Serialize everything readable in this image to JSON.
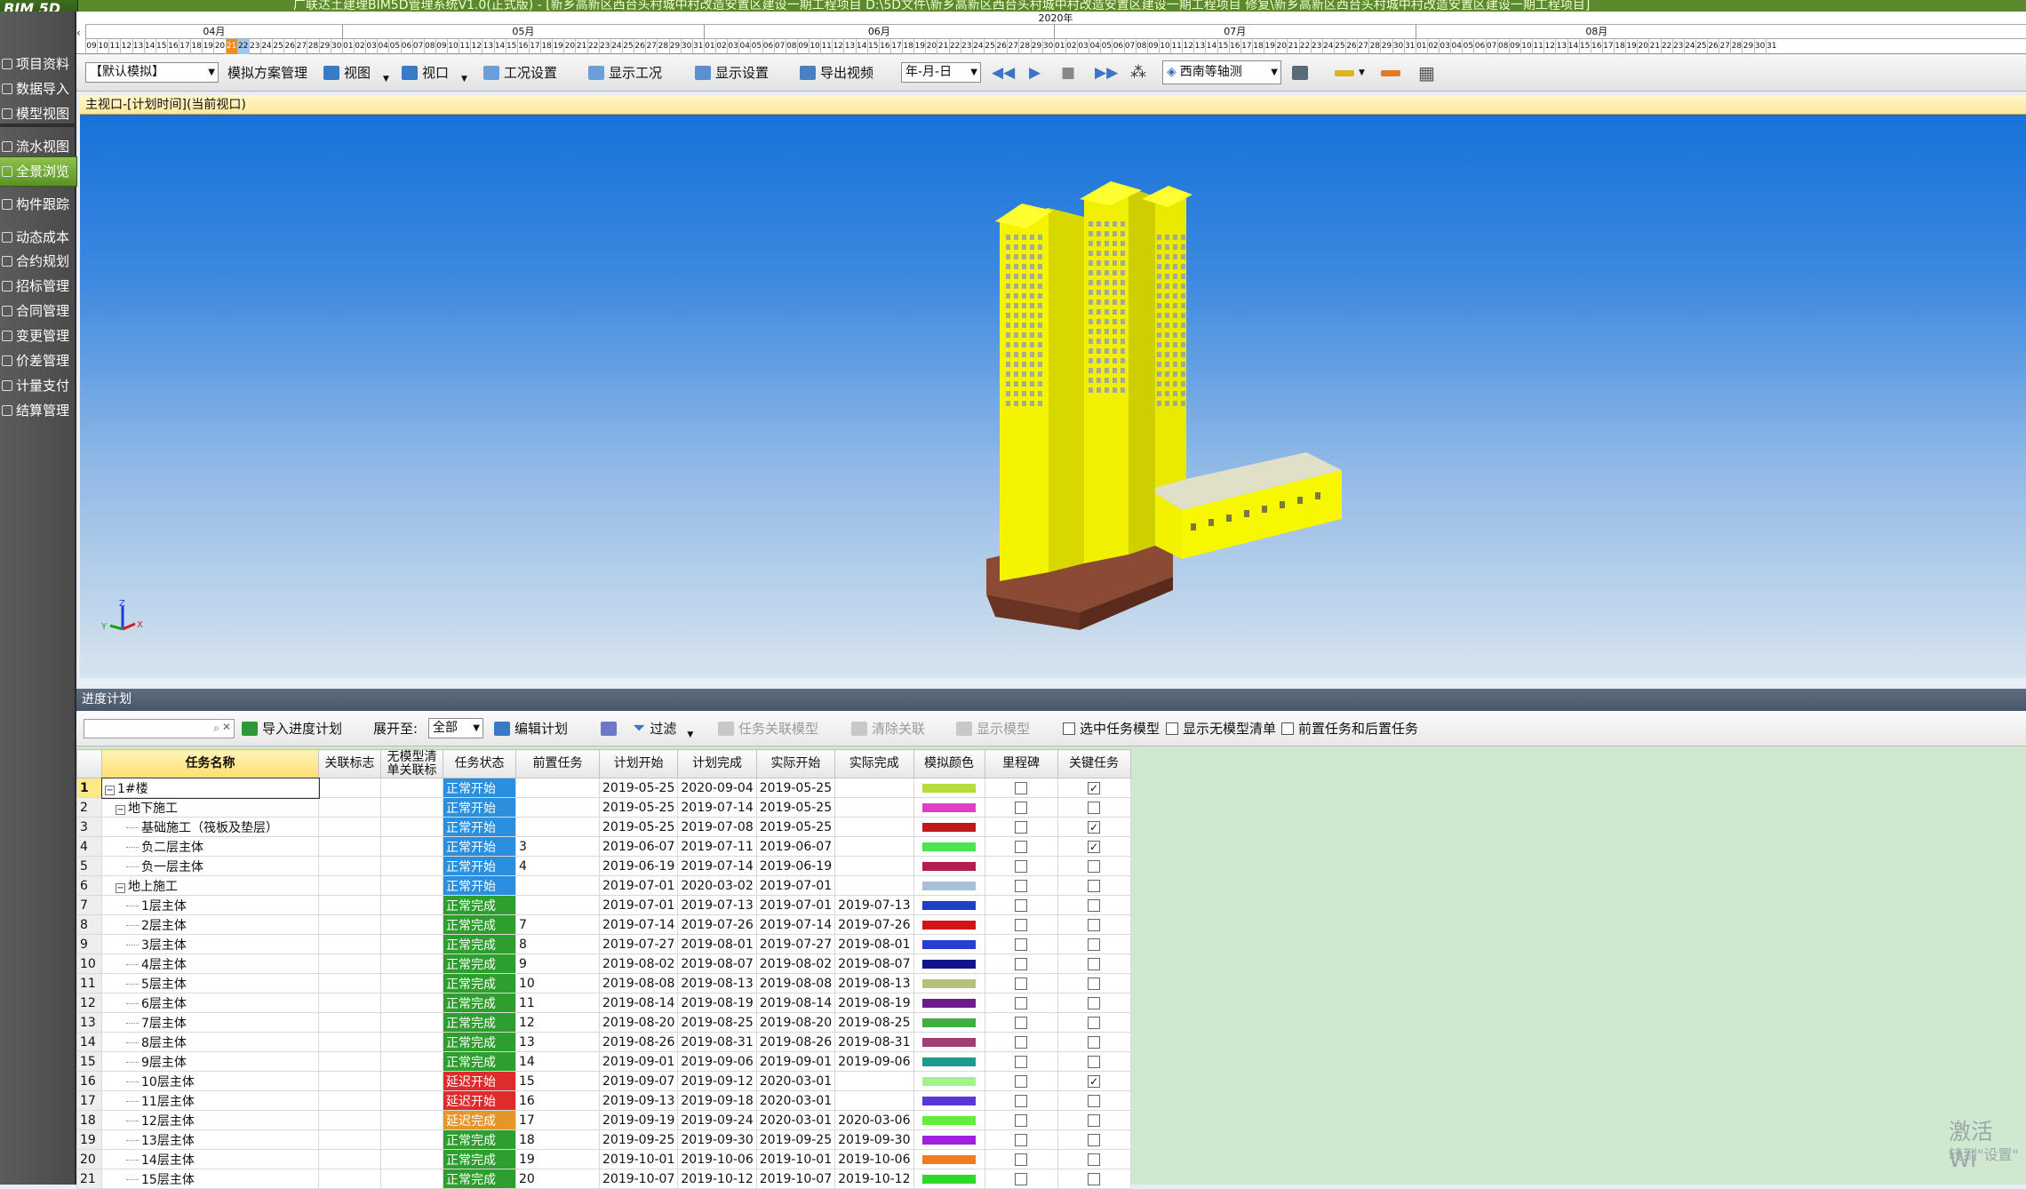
{
  "app": {
    "logo": "BIM 5D",
    "window_title": "广联达土建理BIM5D管理系统V1.0(正式版) - [新乡高新区西台头村城中村改造安置区建设一期工程项目 D:\\5D文件\\新乡高新区西台头村城中村改造安置区建设一期工程项目 修复\\新乡高新区西台头村城中村改造安置区建设一期工程项目]"
  },
  "sidebar": {
    "items": [
      {
        "label": "项目资料",
        "icon": "folder-icon"
      },
      {
        "label": "数据导入",
        "icon": "import-icon"
      },
      {
        "label": "模型视图",
        "icon": "model-icon"
      },
      {
        "label": "流水视图",
        "icon": "flow-icon"
      },
      {
        "label": "全景浏览",
        "icon": "panorama-icon"
      },
      {
        "label": "构件跟踪",
        "icon": "track-icon"
      },
      {
        "label": "动态成本",
        "icon": "cost-icon"
      },
      {
        "label": "合约规划",
        "icon": "contract-plan-icon"
      },
      {
        "label": "招标管理",
        "icon": "bid-icon"
      },
      {
        "label": "合同管理",
        "icon": "contract-icon"
      },
      {
        "label": "变更管理",
        "icon": "change-icon"
      },
      {
        "label": "价差管理",
        "icon": "price-diff-icon"
      },
      {
        "label": "计量支付",
        "icon": "payment-icon"
      },
      {
        "label": "结算管理",
        "icon": "settlement-icon"
      }
    ]
  },
  "timeline": {
    "year": "2020年",
    "months": [
      {
        "label": "04月"
      },
      {
        "label": "05月"
      },
      {
        "label": "06月"
      },
      {
        "label": "07月"
      },
      {
        "label": "08月"
      }
    ],
    "today_day": "21"
  },
  "toolbar": {
    "sim_select": "【默认模拟】",
    "sim_scheme": "模拟方案管理",
    "view": "视图",
    "viewport": "视口",
    "condition_settings": "工况设置",
    "show_condition": "显示工况",
    "display_settings": "显示设置",
    "export_video": "导出视频",
    "date_format": "年-月-日",
    "view_direction": "西南等轴测"
  },
  "viewport": {
    "title": "主视口-[计划时间](当前视口)",
    "axis_z": "Z",
    "axis_y": "Y",
    "axis_x": "X"
  },
  "plan": {
    "header": "进度计划",
    "search_placeholder": "",
    "import_plan": "导入进度计划",
    "expand_label": "展开至:",
    "expand_value": "全部",
    "edit_plan": "编辑计划",
    "filter": "过滤",
    "task_link_model": "任务关联模型",
    "clear_link": "清除关联",
    "show_model": "显示模型",
    "opt_selected_model": "选中任务模型",
    "opt_no_model_list": "显示无模型清单",
    "opt_pre_post": "前置任务和后置任务"
  },
  "grid": {
    "columns": [
      "任务名称",
      "关联标志",
      "无模型清单关联标",
      "任务状态",
      "前置任务",
      "计划开始",
      "计划完成",
      "实际开始",
      "实际完成",
      "模拟颜色",
      "里程碑",
      "关键任务"
    ],
    "rows": [
      {
        "n": "1",
        "name": "1#楼",
        "lvl": 0,
        "exp": "⊟",
        "status": "正常开始",
        "st": "ok",
        "pre": "",
        "ps": "2019-05-25",
        "pf": "2020-09-04",
        "as": "2019-05-25",
        "af": "",
        "color": "#b7dd3c",
        "ms": false,
        "key": true
      },
      {
        "n": "2",
        "name": "地下施工",
        "lvl": 1,
        "exp": "⊟",
        "status": "正常开始",
        "st": "ok",
        "pre": "",
        "ps": "2019-05-25",
        "pf": "2019-07-14",
        "as": "2019-05-25",
        "af": "",
        "color": "#e040c8",
        "ms": false,
        "key": false
      },
      {
        "n": "3",
        "name": "基础施工（筏板及垫层）",
        "lvl": 2,
        "exp": "",
        "status": "正常开始",
        "st": "ok",
        "pre": "",
        "ps": "2019-05-25",
        "pf": "2019-07-08",
        "as": "2019-05-25",
        "af": "",
        "color": "#c0181c",
        "ms": false,
        "key": true
      },
      {
        "n": "4",
        "name": "负二层主体",
        "lvl": 2,
        "exp": "",
        "status": "正常开始",
        "st": "ok",
        "pre": "3",
        "ps": "2019-06-07",
        "pf": "2019-07-11",
        "as": "2019-06-07",
        "af": "",
        "color": "#4ce352",
        "ms": false,
        "key": true
      },
      {
        "n": "5",
        "name": "负一层主体",
        "lvl": 2,
        "exp": "",
        "status": "正常开始",
        "st": "ok",
        "pre": "4",
        "ps": "2019-06-19",
        "pf": "2019-07-14",
        "as": "2019-06-19",
        "af": "",
        "color": "#b01e50",
        "ms": false,
        "key": false
      },
      {
        "n": "6",
        "name": "地上施工",
        "lvl": 1,
        "exp": "⊟",
        "status": "正常开始",
        "st": "ok",
        "pre": "",
        "ps": "2019-07-01",
        "pf": "2020-03-02",
        "as": "2019-07-01",
        "af": "",
        "color": "#a8c0d8",
        "ms": false,
        "key": false
      },
      {
        "n": "7",
        "name": "1层主体",
        "lvl": 2,
        "exp": "",
        "status": "正常完成",
        "st": "done",
        "pre": "",
        "ps": "2019-07-01",
        "pf": "2019-07-13",
        "as": "2019-07-01",
        "af": "2019-07-13",
        "color": "#1e3fbf",
        "ms": false,
        "key": false
      },
      {
        "n": "8",
        "name": "2层主体",
        "lvl": 2,
        "exp": "",
        "status": "正常完成",
        "st": "done",
        "pre": "7",
        "ps": "2019-07-14",
        "pf": "2019-07-26",
        "as": "2019-07-14",
        "af": "2019-07-26",
        "color": "#d41414",
        "ms": false,
        "key": false
      },
      {
        "n": "9",
        "name": "3层主体",
        "lvl": 2,
        "exp": "",
        "status": "正常完成",
        "st": "done",
        "pre": "8",
        "ps": "2019-07-27",
        "pf": "2019-08-01",
        "as": "2019-07-27",
        "af": "2019-08-01",
        "color": "#2540d0",
        "ms": false,
        "key": false
      },
      {
        "n": "10",
        "name": "4层主体",
        "lvl": 2,
        "exp": "",
        "status": "正常完成",
        "st": "done",
        "pre": "9",
        "ps": "2019-08-02",
        "pf": "2019-08-07",
        "as": "2019-08-02",
        "af": "2019-08-07",
        "color": "#14148a",
        "ms": false,
        "key": false
      },
      {
        "n": "11",
        "name": "5层主体",
        "lvl": 2,
        "exp": "",
        "status": "正常完成",
        "st": "done",
        "pre": "10",
        "ps": "2019-08-08",
        "pf": "2019-08-13",
        "as": "2019-08-08",
        "af": "2019-08-13",
        "color": "#b5c07a",
        "ms": false,
        "key": false
      },
      {
        "n": "12",
        "name": "6层主体",
        "lvl": 2,
        "exp": "",
        "status": "正常完成",
        "st": "done",
        "pre": "11",
        "ps": "2019-08-14",
        "pf": "2019-08-19",
        "as": "2019-08-14",
        "af": "2019-08-19",
        "color": "#6e1e8a",
        "ms": false,
        "key": false
      },
      {
        "n": "13",
        "name": "7层主体",
        "lvl": 2,
        "exp": "",
        "status": "正常完成",
        "st": "done",
        "pre": "12",
        "ps": "2019-08-20",
        "pf": "2019-08-25",
        "as": "2019-08-20",
        "af": "2019-08-25",
        "color": "#3fb03f",
        "ms": false,
        "key": false
      },
      {
        "n": "14",
        "name": "8层主体",
        "lvl": 2,
        "exp": "",
        "status": "正常完成",
        "st": "done",
        "pre": "13",
        "ps": "2019-08-26",
        "pf": "2019-08-31",
        "as": "2019-08-26",
        "af": "2019-08-31",
        "color": "#a04070",
        "ms": false,
        "key": false
      },
      {
        "n": "15",
        "name": "9层主体",
        "lvl": 2,
        "exp": "",
        "status": "正常完成",
        "st": "done",
        "pre": "14",
        "ps": "2019-09-01",
        "pf": "2019-09-06",
        "as": "2019-09-01",
        "af": "2019-09-06",
        "color": "#1e9a8a",
        "ms": false,
        "key": false
      },
      {
        "n": "16",
        "name": "10层主体",
        "lvl": 2,
        "exp": "",
        "status": "延迟开始",
        "st": "late",
        "pre": "15",
        "ps": "2019-09-07",
        "pf": "2019-09-12",
        "as": "2020-03-01",
        "af": "",
        "color": "#a6f28a",
        "ms": false,
        "key": true
      },
      {
        "n": "17",
        "name": "11层主体",
        "lvl": 2,
        "exp": "",
        "status": "延迟开始",
        "st": "late",
        "pre": "16",
        "ps": "2019-09-13",
        "pf": "2019-09-18",
        "as": "2020-03-01",
        "af": "",
        "color": "#5a36d8",
        "ms": false,
        "key": false
      },
      {
        "n": "18",
        "name": "12层主体",
        "lvl": 2,
        "exp": "",
        "status": "延迟完成",
        "st": "latedone",
        "pre": "17",
        "ps": "2019-09-19",
        "pf": "2019-09-24",
        "as": "2020-03-01",
        "af": "2020-03-06",
        "color": "#62ef3c",
        "ms": false,
        "key": false
      },
      {
        "n": "19",
        "name": "13层主体",
        "lvl": 2,
        "exp": "",
        "status": "正常完成",
        "st": "done",
        "pre": "18",
        "ps": "2019-09-25",
        "pf": "2019-09-30",
        "as": "2019-09-25",
        "af": "2019-09-30",
        "color": "#a020e0",
        "ms": false,
        "key": false
      },
      {
        "n": "20",
        "name": "14层主体",
        "lvl": 2,
        "exp": "",
        "status": "正常完成",
        "st": "done",
        "pre": "19",
        "ps": "2019-10-01",
        "pf": "2019-10-06",
        "as": "2019-10-01",
        "af": "2019-10-06",
        "color": "#f07a1e",
        "ms": false,
        "key": false
      },
      {
        "n": "21",
        "name": "15层主体",
        "lvl": 2,
        "exp": "",
        "status": "正常完成",
        "st": "done",
        "pre": "20",
        "ps": "2019-10-07",
        "pf": "2019-10-12",
        "as": "2019-10-07",
        "af": "2019-10-12",
        "color": "#2ed828",
        "ms": false,
        "key": false
      }
    ]
  },
  "watermark": {
    "line1": "激活 Wi",
    "line2": "转到\"设置\""
  }
}
